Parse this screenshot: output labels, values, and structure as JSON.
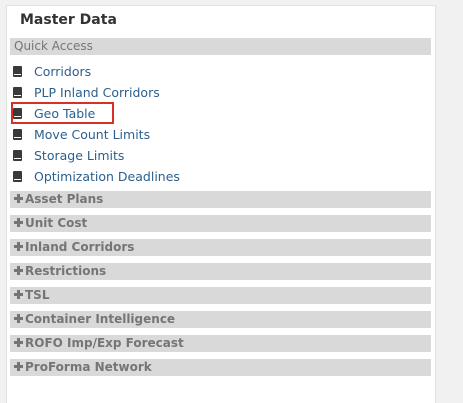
{
  "panel": {
    "title": "Master Data"
  },
  "quick_access": {
    "label": "Quick Access",
    "items": [
      {
        "label": "Corridors",
        "icon": "book-icon"
      },
      {
        "label": "PLP Inland Corridors",
        "icon": "book-icon"
      },
      {
        "label": "Geo Table",
        "icon": "book-icon",
        "highlighted": true
      },
      {
        "label": "Move Count Limits",
        "icon": "book-icon"
      },
      {
        "label": "Storage Limits",
        "icon": "book-icon"
      },
      {
        "label": "Optimization Deadlines",
        "icon": "book-icon"
      }
    ]
  },
  "sections": [
    {
      "label": "Asset Plans",
      "icon": "plus-icon"
    },
    {
      "label": "Unit Cost",
      "icon": "plus-icon"
    },
    {
      "label": "Inland Corridors",
      "icon": "plus-icon"
    },
    {
      "label": "Restrictions",
      "icon": "plus-icon"
    },
    {
      "label": "TSL",
      "icon": "plus-icon"
    },
    {
      "label": "Container Intelligence",
      "icon": "plus-icon"
    },
    {
      "label": "ROFO Imp/Exp Forecast",
      "icon": "plus-icon"
    },
    {
      "label": "ProForma Network",
      "icon": "plus-icon"
    }
  ],
  "colors": {
    "link": "#2c5f8e",
    "bar_bg": "#d9d9d9",
    "bar_text": "#757575",
    "highlight": "#d93025"
  }
}
